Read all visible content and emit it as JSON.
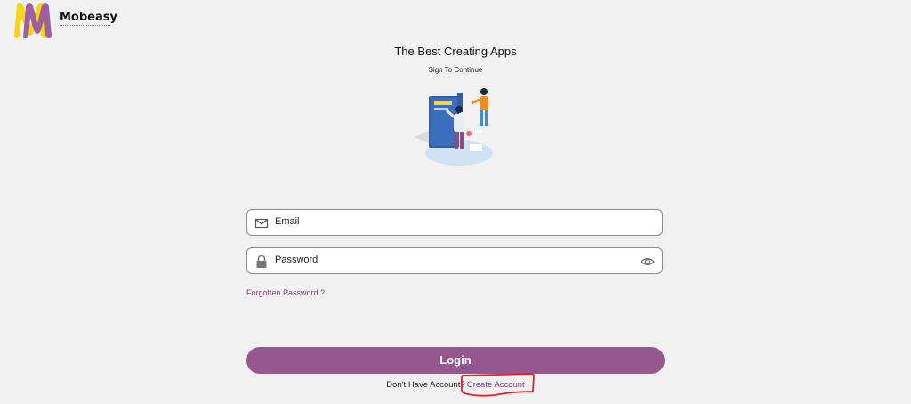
{
  "brand": {
    "name": "Mobeasy",
    "logo_icon": "m-logo-icon",
    "colors": {
      "yellow": "#f6d51a",
      "purple": "#9a56a0"
    }
  },
  "header": {
    "title": "The Best Creating Apps",
    "subtitle": "Sign To Continue"
  },
  "illustration": {
    "icon": "people-at-screen-illustration"
  },
  "form": {
    "email": {
      "placeholder": "Email",
      "icon": "mail-icon"
    },
    "password": {
      "placeholder": "Password",
      "icon": "lock-icon",
      "toggle_icon": "eye-icon"
    },
    "forgot_label": "Forgotten Password ?",
    "login_label": "Login",
    "no_account_text": "Don't Have Account?",
    "create_account_label": "Create Account"
  },
  "colors": {
    "accent": "#96578f",
    "link": "#8b3f85",
    "annotation": "#e0212b",
    "background": "#f1f1f1"
  }
}
